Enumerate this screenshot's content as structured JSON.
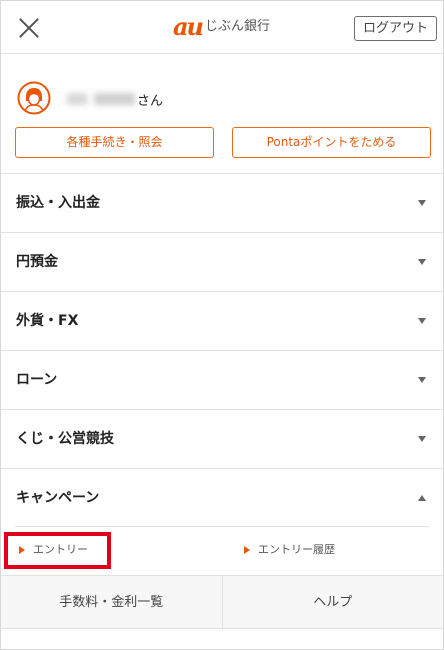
{
  "header": {
    "brand_mark": "au",
    "brand_name": "じぶん銀行",
    "logout_label": "ログアウト"
  },
  "user": {
    "honorific": "さん"
  },
  "actions": {
    "procedures_label": "各種手続き・照会",
    "ponta_label": "Pontaポイントをためる"
  },
  "menu": {
    "items": [
      {
        "label": "振込・入出金",
        "expanded": false
      },
      {
        "label": "円預金",
        "expanded": false
      },
      {
        "label": "外貨・FX",
        "expanded": false
      },
      {
        "label": "ローン",
        "expanded": false
      },
      {
        "label": "くじ・公営競技",
        "expanded": false
      },
      {
        "label": "キャンペーン",
        "expanded": true
      }
    ],
    "campaign_sub": {
      "entry_label": "エントリー",
      "history_label": "エントリー履歴"
    }
  },
  "footer": {
    "fees_label": "手数料・金利一覧",
    "help_label": "ヘルプ"
  },
  "colors": {
    "accent": "#eb5505",
    "highlight": "#e0001a"
  }
}
